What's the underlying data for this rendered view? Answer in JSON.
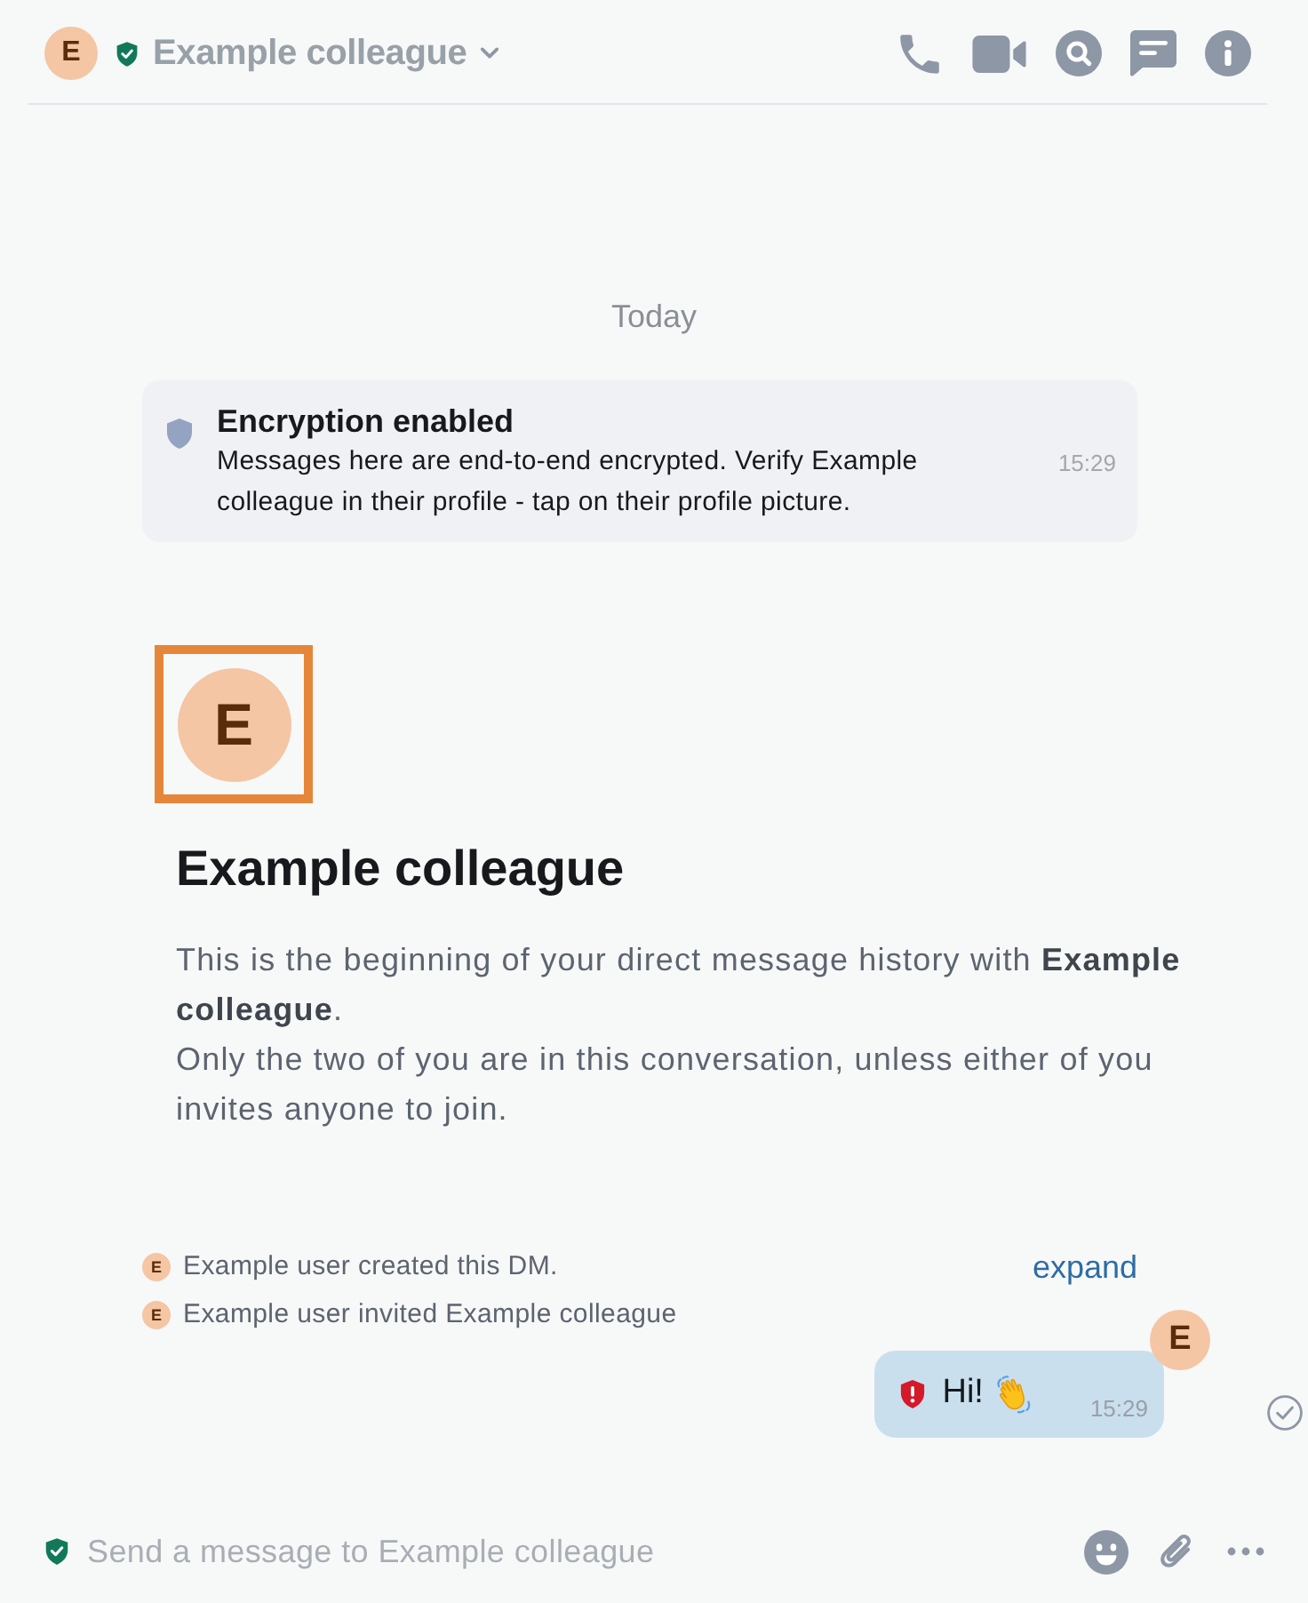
{
  "header": {
    "avatar_initial": "E",
    "verified": true,
    "room_name": "Example colleague"
  },
  "timeline": {
    "date_separator": "Today",
    "encryption_notice": {
      "title": "Encryption enabled",
      "body": "Messages here are end-to-end encrypted. Verify Example colleague in their profile - tap on their profile picture.",
      "time": "15:29"
    },
    "room_intro": {
      "avatar_initial": "E",
      "highlighted": true,
      "name": "Example colleague",
      "paragraphs": [
        "This is the beginning of your direct message history with **Example colleague**.",
        "Only the two of you are in this conversation, unless either of you invites anyone to join."
      ]
    },
    "events": [
      {
        "avatar_initial": "E",
        "text": "Example user created this DM."
      },
      {
        "avatar_initial": "E",
        "text": "Example user invited Example colleague"
      }
    ],
    "expand_link": "expand",
    "messages": [
      {
        "sender_initial": "E",
        "unverified": true,
        "text": "Hi!",
        "time": "15:29",
        "sent": true
      }
    ]
  },
  "composer": {
    "encrypted": true,
    "placeholder": "Send a message to Example colleague"
  }
}
